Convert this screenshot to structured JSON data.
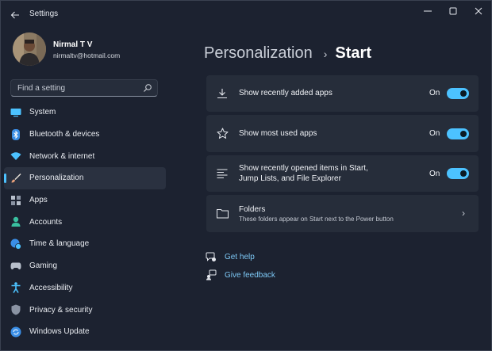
{
  "window": {
    "title": "Settings",
    "back_icon": "back-arrow-icon",
    "controls": [
      "minimize-icon",
      "maximize-icon",
      "close-icon"
    ]
  },
  "profile": {
    "name": "Nirmal T V",
    "email": "nirmaltv@hotmail.com"
  },
  "search": {
    "placeholder": "Find a setting",
    "icon": "search-icon"
  },
  "nav": {
    "items": [
      {
        "label": "System",
        "icon": "system-monitor-icon",
        "color": "#4cc2ff"
      },
      {
        "label": "Bluetooth & devices",
        "icon": "bluetooth-icon",
        "color": "#3a8ee6"
      },
      {
        "label": "Network & internet",
        "icon": "wifi-icon",
        "color": "#4cc2ff"
      },
      {
        "label": "Personalization",
        "icon": "paintbrush-icon",
        "color": "#e8a07a",
        "active": true
      },
      {
        "label": "Apps",
        "icon": "apps-icon",
        "color": "#b8c0cc"
      },
      {
        "label": "Accounts",
        "icon": "accounts-icon",
        "color": "#39c0a0"
      },
      {
        "label": "Time & language",
        "icon": "globe-clock-icon",
        "color": "#3a8ee6"
      },
      {
        "label": "Gaming",
        "icon": "gamepad-icon",
        "color": "#b8c0cc"
      },
      {
        "label": "Accessibility",
        "icon": "accessibility-icon",
        "color": "#4cc2ff"
      },
      {
        "label": "Privacy & security",
        "icon": "shield-icon",
        "color": "#8a93a3"
      },
      {
        "label": "Windows Update",
        "icon": "update-icon",
        "color": "#3a8ee6"
      }
    ]
  },
  "breadcrumb": {
    "parent": "Personalization",
    "separator": "›",
    "current": "Start"
  },
  "settings": [
    {
      "title": "Show recently added apps",
      "state": "On",
      "on": true,
      "icon": "download-icon"
    },
    {
      "title": "Show most used apps",
      "state": "On",
      "on": true,
      "icon": "star-icon"
    },
    {
      "title_line1": "Show recently opened items in Start,",
      "title_line2": "Jump Lists, and File Explorer",
      "state": "On",
      "on": true,
      "icon": "list-lines-icon"
    },
    {
      "title": "Folders",
      "subtitle": "These folders appear on Start next to the Power button",
      "icon": "folder-icon",
      "chevron": "›"
    }
  ],
  "links": [
    {
      "label": "Get help",
      "icon": "help-chat-icon"
    },
    {
      "label": "Give feedback",
      "icon": "feedback-icon"
    }
  ],
  "colors": {
    "accent": "#4cc2ff",
    "link": "#7dc8f5",
    "background": "#1c2230",
    "card": "#262d3a"
  }
}
